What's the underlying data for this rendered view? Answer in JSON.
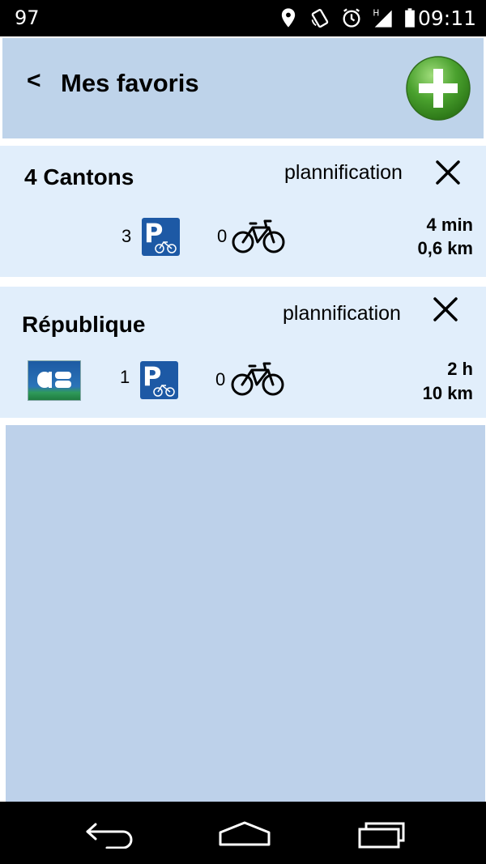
{
  "status_bar": {
    "left_number": "97",
    "time": "09:11",
    "icons": [
      "location-icon",
      "rotate-icon",
      "alarm-icon",
      "signal-icon",
      "battery-icon"
    ]
  },
  "header": {
    "back_label": "<",
    "title": "Mes favoris",
    "add_icon": "plus-icon"
  },
  "favorites": [
    {
      "name": "4 Cantons",
      "plan_label": "plannification",
      "parking_count": "3",
      "bike_count": "0",
      "duration": "4 min",
      "distance": "0,6 km",
      "has_cb": false
    },
    {
      "name": "République",
      "plan_label": "plannification",
      "parking_count": "1",
      "bike_count": "0",
      "duration": "2 h",
      "distance": "10 km",
      "has_cb": true
    }
  ],
  "nav_bar": {
    "icons": [
      "back-icon",
      "home-icon",
      "recent-apps-icon"
    ]
  },
  "colors": {
    "header_bg": "#bed3ea",
    "card_bg": "#e1eefb",
    "parking_blue": "#1d59a5",
    "add_green": "#4aa12e"
  }
}
